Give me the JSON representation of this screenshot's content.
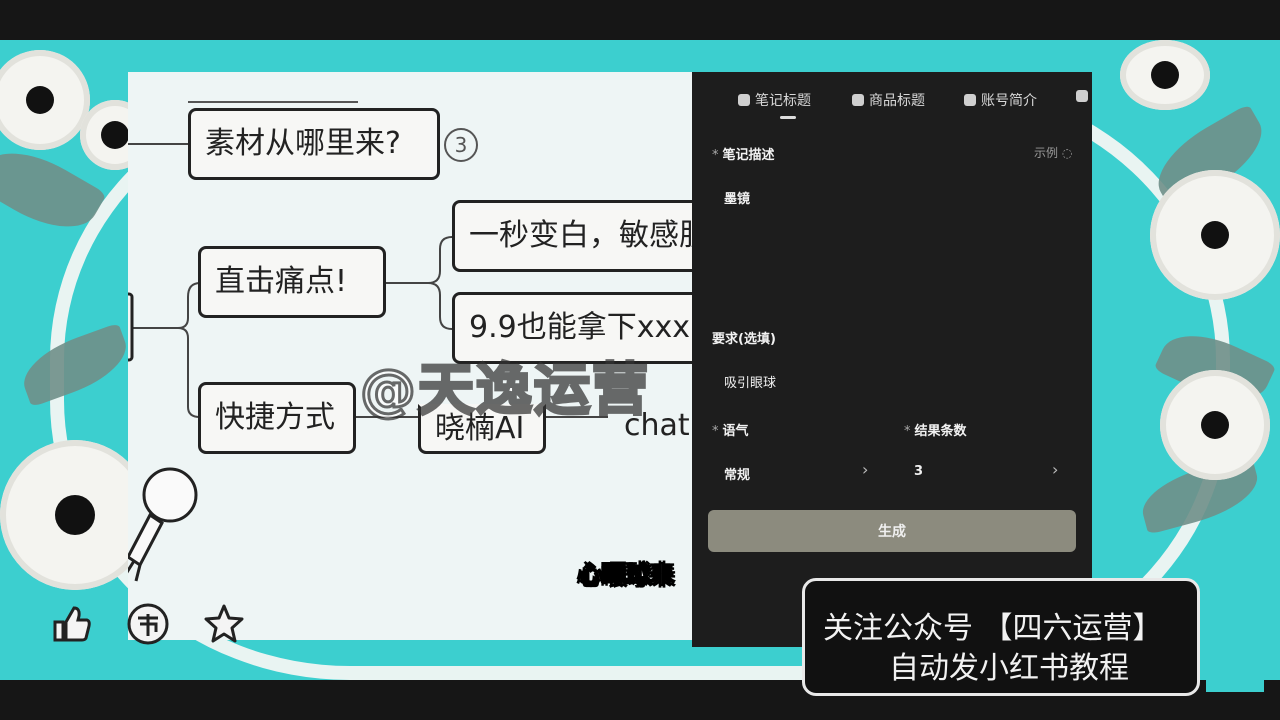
{
  "colors": {
    "frame_teal": "#3ccfcf",
    "panel_bg": "#1d1d1d",
    "generate_button": "#8c8b7e",
    "mindmap_bg": "#eef5f5"
  },
  "mindmap": {
    "node_source": "素材从哪里来?",
    "node_source_badge": "3",
    "node_pain": "直击痛点!",
    "node_pain_child1": "一秒变白，敏感肌",
    "node_pain_child2": "9.9也能拿下xxx，",
    "node_shortcut": "快捷方式",
    "node_shortcut_child1": "晓楠AI",
    "node_shortcut_child2": "chat."
  },
  "panel": {
    "tabs": [
      {
        "label": "笔记标题",
        "icon": "note-icon"
      },
      {
        "label": "商品标题",
        "icon": "product-icon"
      },
      {
        "label": "账号简介",
        "icon": "account-icon"
      }
    ],
    "description_label": "笔记描述",
    "example_link": "示例",
    "description_value": "墨镜",
    "requirements_label": "要求(选填)",
    "requirements_value": "吸引眼球",
    "tone_label": "语气",
    "tone_value": "常规",
    "result_count_label": "结果条数",
    "result_count_value": "3",
    "generate_label": "生成"
  },
  "overlay": {
    "watermark": "@天逸运营",
    "subtitle": "心眼球来",
    "promo_line1": "关注公众号 【四六运营】",
    "promo_line2": "自动发小红书教程"
  },
  "bottom_icons": [
    "thumbs-up-icon",
    "coin-icon",
    "star-icon"
  ]
}
